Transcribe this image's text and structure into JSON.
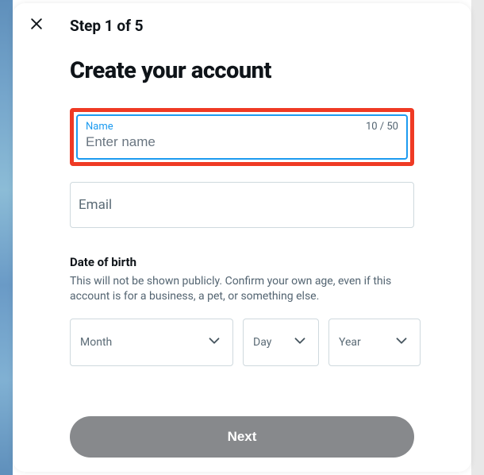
{
  "header": {
    "step_text": "Step 1 of 5"
  },
  "title": "Create your account",
  "name_field": {
    "label": "Name",
    "placeholder": "Enter name",
    "value": "",
    "char_count": "10 / 50"
  },
  "email_field": {
    "placeholder": "Email"
  },
  "dob": {
    "heading": "Date of birth",
    "description": "This will not be shown publicly. Confirm your own age, even if this account is for a business, a pet, or something else.",
    "month_label": "Month",
    "day_label": "Day",
    "year_label": "Year"
  },
  "footer": {
    "next_label": "Next"
  }
}
